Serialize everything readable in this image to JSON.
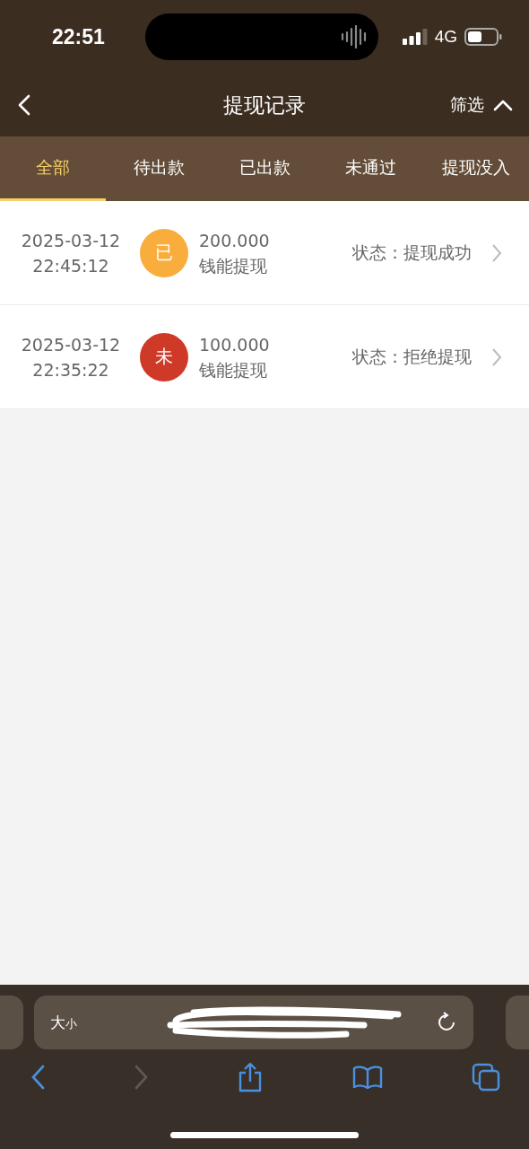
{
  "status_bar": {
    "time": "22:51",
    "network": "4G"
  },
  "nav": {
    "title": "提现记录",
    "filter": "筛选",
    "filter_expanded": true
  },
  "tabs": [
    {
      "label": "全部",
      "selected": true
    },
    {
      "label": "待出款",
      "selected": false
    },
    {
      "label": "已出款",
      "selected": false
    },
    {
      "label": "未通过",
      "selected": false
    },
    {
      "label": "提现没入",
      "selected": false
    }
  ],
  "records": [
    {
      "date": "2025-03-12",
      "time": "22:45:12",
      "badge": "已",
      "color": "#f9ad3d",
      "amount": "200.000",
      "label": "钱能提现",
      "status": "状态：提现成功"
    },
    {
      "date": "2025-03-12",
      "time": "22:35:22",
      "badge": "未",
      "color": "#cf3a28",
      "amount": "100.000",
      "label": "钱能提现",
      "status": "状态：拒绝提现"
    }
  ],
  "browser": {
    "size_large": "大",
    "size_small": "小",
    "forward_disabled": true
  }
}
